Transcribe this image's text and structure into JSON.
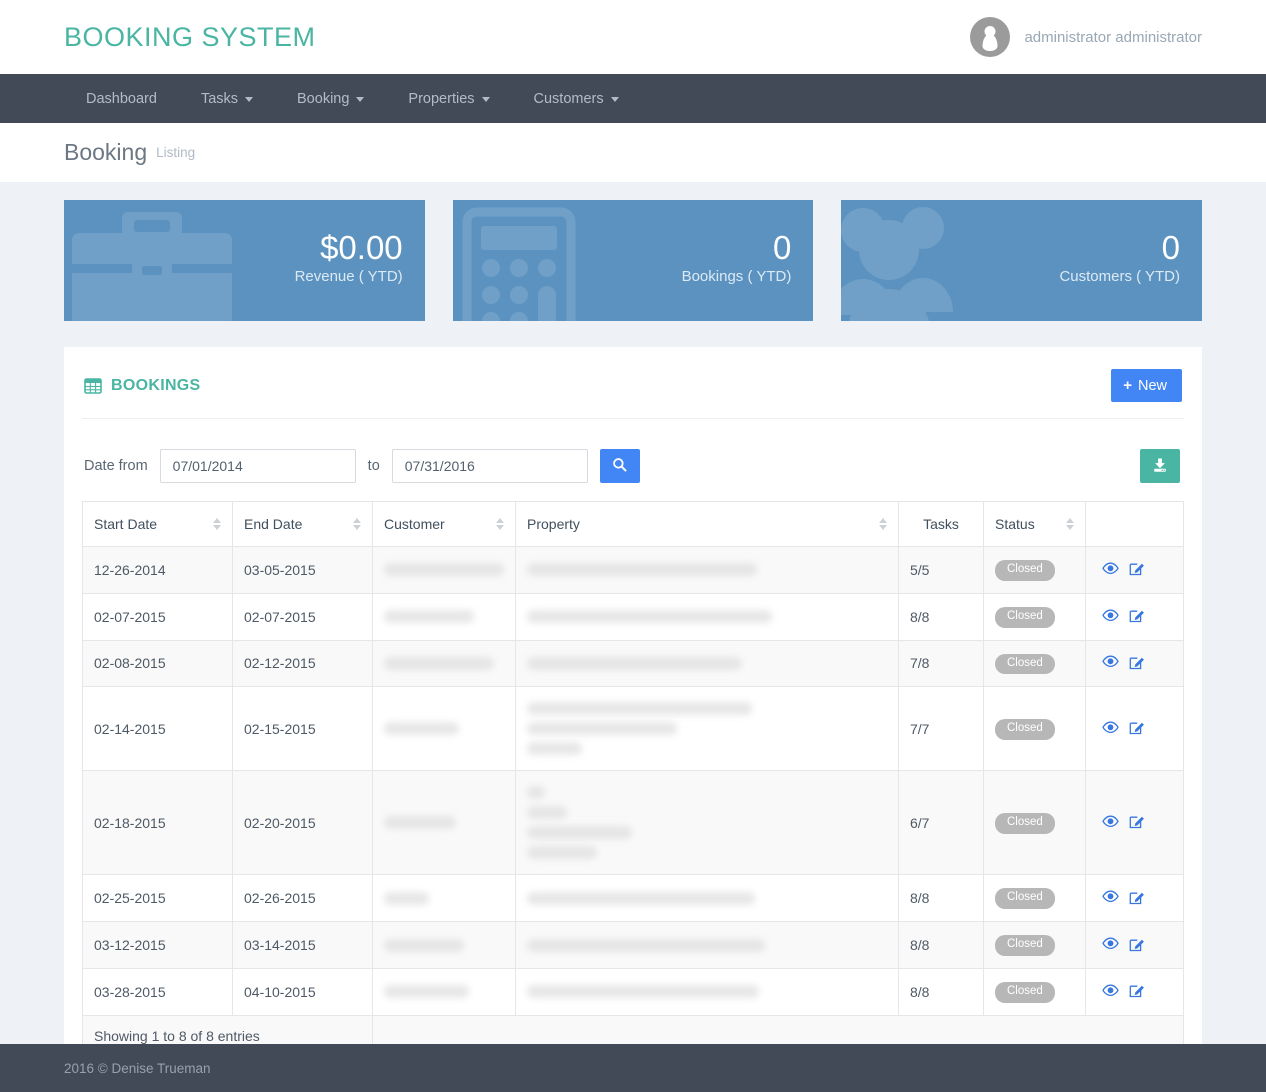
{
  "brand": {
    "title": "BOOKING SYSTEM",
    "color": "#4ab5a2"
  },
  "user": {
    "name": "administrator administrator",
    "avatar_icon": "user-circle-icon"
  },
  "nav": {
    "items": [
      {
        "label": "Dashboard",
        "caret": false
      },
      {
        "label": "Tasks",
        "caret": true
      },
      {
        "label": "Booking",
        "caret": true
      },
      {
        "label": "Properties",
        "caret": true
      },
      {
        "label": "Customers",
        "caret": true
      }
    ]
  },
  "page": {
    "title": "Booking",
    "subtitle": "Listing"
  },
  "cards": [
    {
      "value": "$0.00",
      "label": "Revenue ( YTD)",
      "icon": "briefcase-icon",
      "color": "#5b92bf"
    },
    {
      "value": "0",
      "label": "Bookings ( YTD)",
      "icon": "calculator-icon",
      "color": "#5b92bf"
    },
    {
      "value": "0",
      "label": "Customers ( YTD)",
      "icon": "users-icon",
      "color": "#5b92bf"
    }
  ],
  "panel": {
    "title": "BOOKINGS",
    "title_icon": "table-grid-icon",
    "new_button": {
      "label": "New",
      "icon": "plus-icon",
      "color": "#4285f4"
    },
    "filter": {
      "from_label": "Date from",
      "from_value": "07/01/2014",
      "to_label": "to",
      "to_value": "07/31/2016",
      "search_icon": "search-icon",
      "export_icon": "download-icon",
      "export_color": "#4ab5a2"
    },
    "table": {
      "columns": [
        {
          "label": "Start Date",
          "sortable": true
        },
        {
          "label": "End Date",
          "sortable": true
        },
        {
          "label": "Customer",
          "sortable": true
        },
        {
          "label": "Property",
          "sortable": true
        },
        {
          "label": "Tasks",
          "sortable": false
        },
        {
          "label": "Status",
          "sortable": true
        },
        {
          "label": "",
          "sortable": false
        }
      ],
      "rows": [
        {
          "start": "12-26-2014",
          "end": "03-05-2015",
          "customer_lines": [
            120
          ],
          "property_lines": [
            230
          ],
          "tasks": "5/5",
          "status": "Closed"
        },
        {
          "start": "02-07-2015",
          "end": "02-07-2015",
          "customer_lines": [
            90
          ],
          "property_lines": [
            245
          ],
          "tasks": "8/8",
          "status": "Closed"
        },
        {
          "start": "02-08-2015",
          "end": "02-12-2015",
          "customer_lines": [
            110
          ],
          "property_lines": [
            215
          ],
          "tasks": "7/8",
          "status": "Closed"
        },
        {
          "start": "02-14-2015",
          "end": "02-15-2015",
          "customer_lines": [
            75
          ],
          "property_lines": [
            225,
            150,
            55
          ],
          "tasks": "7/7",
          "status": "Closed"
        },
        {
          "start": "02-18-2015",
          "end": "02-20-2015",
          "customer_lines": [
            72
          ],
          "property_lines": [
            18,
            40,
            105,
            70
          ],
          "tasks": "6/7",
          "status": "Closed"
        },
        {
          "start": "02-25-2015",
          "end": "02-26-2015",
          "customer_lines": [
            45
          ],
          "property_lines": [
            228
          ],
          "tasks": "8/8",
          "status": "Closed"
        },
        {
          "start": "03-12-2015",
          "end": "03-14-2015",
          "customer_lines": [
            80
          ],
          "property_lines": [
            238
          ],
          "tasks": "8/8",
          "status": "Closed"
        },
        {
          "start": "03-28-2015",
          "end": "04-10-2015",
          "customer_lines": [
            85
          ],
          "property_lines": [
            232
          ],
          "tasks": "8/8",
          "status": "Closed"
        }
      ],
      "row_actions": [
        {
          "icon": "eye-icon",
          "title": "View"
        },
        {
          "icon": "edit-icon",
          "title": "Edit"
        }
      ],
      "footer_text": "Showing 1 to 8 of 8 entries"
    }
  },
  "footer": {
    "text": "2016 © Denise Trueman"
  }
}
